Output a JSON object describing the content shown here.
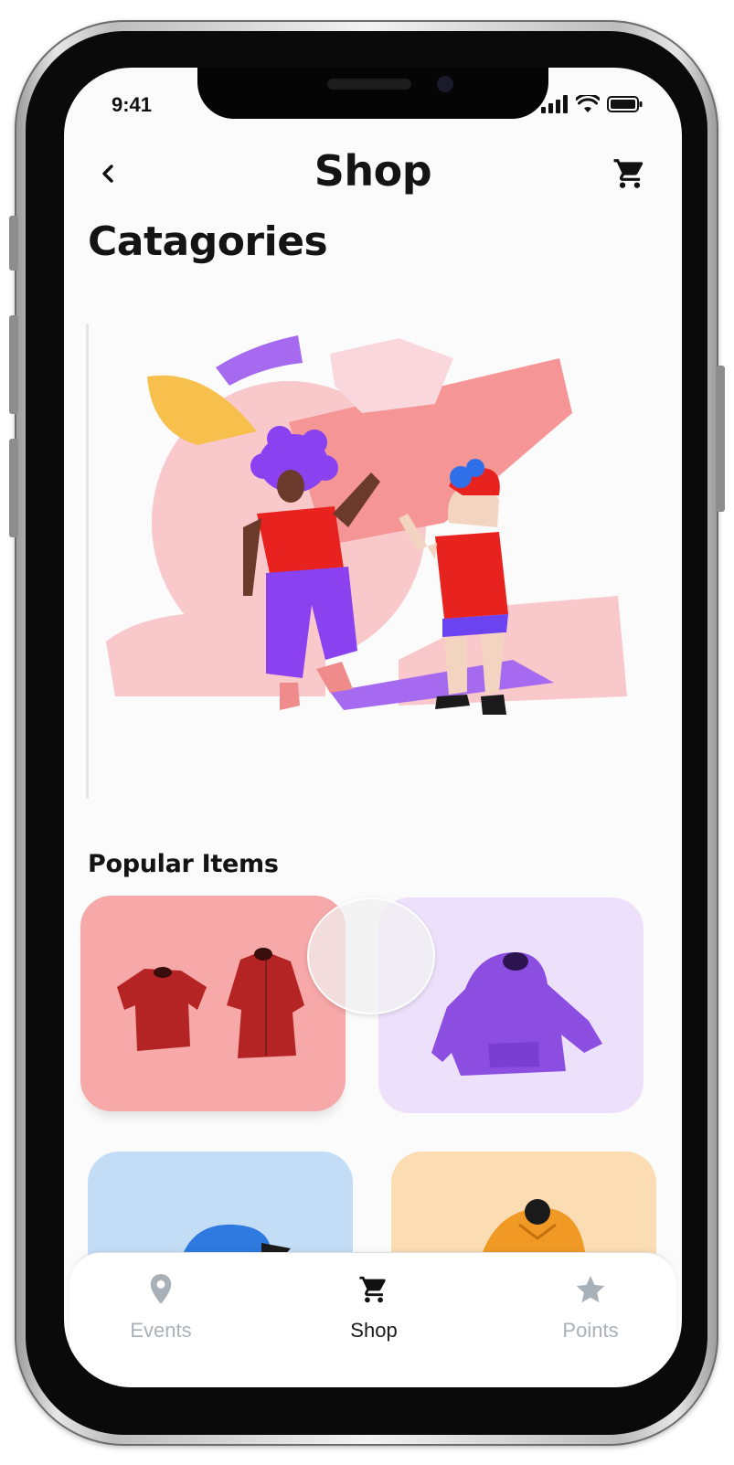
{
  "status_bar": {
    "time": "9:41"
  },
  "header": {
    "title": "Shop",
    "back_icon": "chevron-left-icon",
    "cart_icon": "cart-icon"
  },
  "categories": {
    "title": "Catagories"
  },
  "popular": {
    "title": "Popular Items",
    "items": [
      {
        "name": "red-shirts",
        "color": "#f7a8a8"
      },
      {
        "name": "purple-hoodie",
        "color": "#ece0fa"
      },
      {
        "name": "blue-cap",
        "color": "#c3ddf7"
      },
      {
        "name": "orange-sweater",
        "color": "#fbdcb3"
      }
    ]
  },
  "bottom_nav": {
    "items": [
      {
        "label": "Events",
        "icon": "location-pin-icon",
        "active": false
      },
      {
        "label": "Shop",
        "icon": "cart-icon",
        "active": true
      },
      {
        "label": "Points",
        "icon": "star-icon",
        "active": false
      }
    ]
  },
  "colors": {
    "text_primary": "#141414",
    "nav_inactive": "#a8b1b8",
    "card_red": "#f7a8a8",
    "card_purple": "#ece0fa",
    "card_blue": "#c3ddf7",
    "card_orange": "#fbdcb3"
  }
}
